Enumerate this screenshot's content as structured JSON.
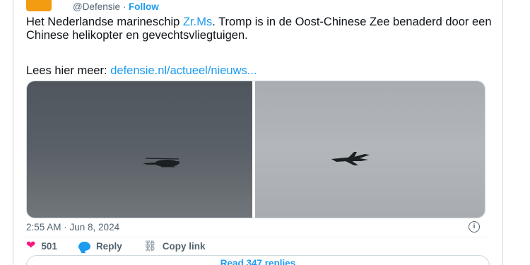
{
  "header": {
    "handle": "@Defensie",
    "separator": " · ",
    "follow_label": "Follow"
  },
  "tweet": {
    "text_before": "Het Nederlandse marineschip ",
    "mention": "Zr.Ms",
    "text_after": ". Tromp is in de Oost-Chinese Zee benaderd door een Chinese helikopter en gevechtsvliegtuigen.",
    "more_prefix": "Lees hier meer: ",
    "link_text": "defensie.nl/actueel/nieuws..."
  },
  "media": {
    "images": [
      {
        "subject": "helicopter-over-sea"
      },
      {
        "subject": "fighter-jet-in-sky"
      }
    ]
  },
  "meta": {
    "timestamp": "2:55 AM · Jun 8, 2024",
    "info_icon": "i"
  },
  "actions": {
    "likes": "501",
    "reply_label": "Reply",
    "copy_link_label": "Copy link"
  },
  "footer": {
    "read_replies_label": "Read 347 replies"
  },
  "colors": {
    "accent": "#1d9bf0",
    "like": "#f91880",
    "muted": "#536471"
  }
}
